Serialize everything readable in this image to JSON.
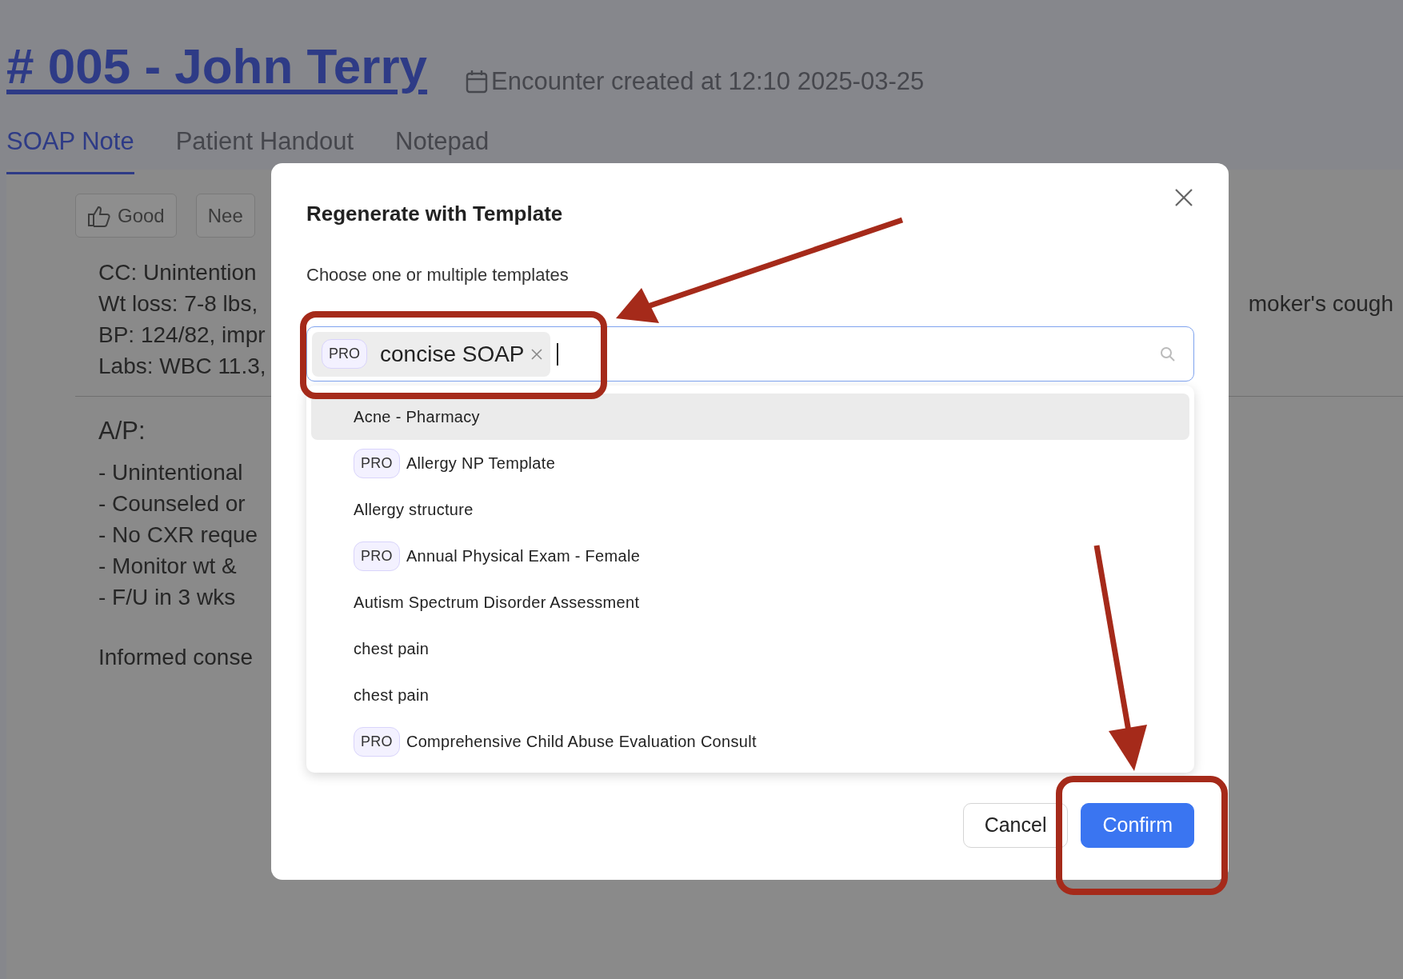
{
  "header": {
    "title": "# 005 - John Terry",
    "created": "Encounter created at 12:10 2025-03-25"
  },
  "tabs": [
    {
      "label": "SOAP Note",
      "selected": true
    },
    {
      "label": "Patient Handout",
      "selected": false
    },
    {
      "label": "Notepad",
      "selected": false
    }
  ],
  "feedback_buttons": [
    {
      "label": "Good",
      "kind": "thumb"
    },
    {
      "label": "Nee",
      "kind": "plain"
    }
  ],
  "note": {
    "summary_lines": [
      {
        "left": "CC: Unintention"
      },
      {
        "left": "Wt loss: 7-8 lbs,",
        "right": "moker's cough"
      },
      {
        "left": "BP: 124/82, impr"
      },
      {
        "left": "Labs: WBC 11.3,"
      }
    ],
    "ap_heading": "A/P:",
    "ap_lines": [
      "- Unintentional",
      "- Counseled or",
      "- No CXR reque",
      "- Monitor wt &",
      "- F/U in 3 wks"
    ],
    "footer": "Informed conse"
  },
  "dialog": {
    "title": "Regenerate with Template",
    "prompt": "Choose one or multiple templates",
    "selected_templates": [
      {
        "badge": "PRO",
        "label": "concise SOAP"
      }
    ],
    "options": [
      {
        "label": "Acne - Pharmacy",
        "highlighted": true
      },
      {
        "badge": "PRO",
        "label": "Allergy NP Template",
        "highlighted": false
      },
      {
        "label": "Allergy structure",
        "highlighted": false
      },
      {
        "badge": "PRO",
        "label": "Annual Physical Exam - Female",
        "highlighted": false
      },
      {
        "label": "Autism Spectrum Disorder Assessment",
        "highlighted": false
      },
      {
        "label": "chest pain",
        "highlighted": false
      },
      {
        "label": "chest pain",
        "highlighted": false
      },
      {
        "badge": "PRO",
        "label": "Comprehensive Child Abuse Evaluation Consult",
        "highlighted": false
      }
    ],
    "buttons": [
      {
        "label": "Cancel",
        "kind": "secondary"
      },
      {
        "label": "Confirm",
        "kind": "primary"
      }
    ]
  }
}
